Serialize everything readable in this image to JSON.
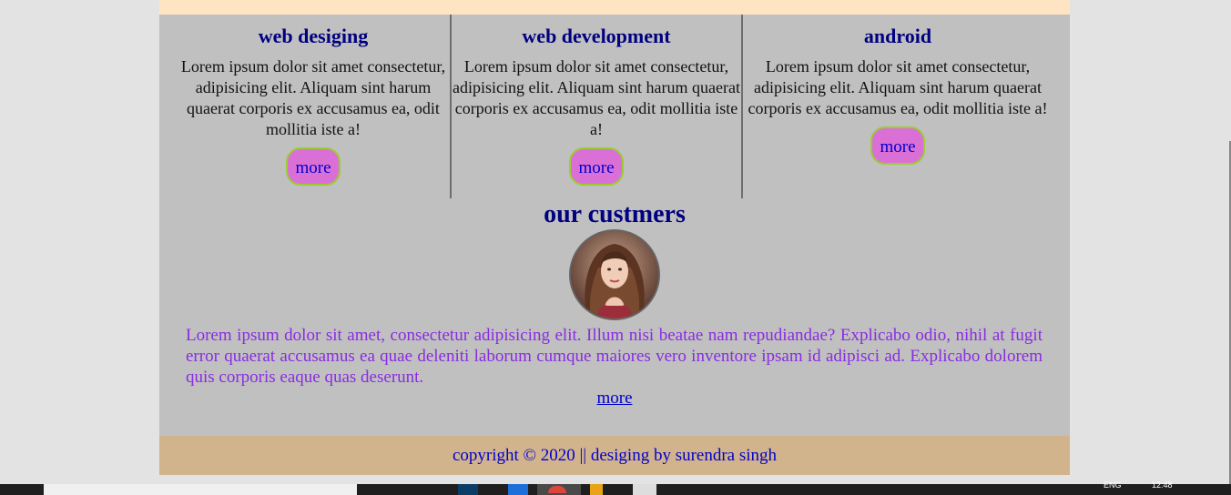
{
  "services": [
    {
      "title": "web desiging",
      "text": "Lorem ipsum dolor sit amet consectetur, adipisicing elit. Aliquam sint harum quaerat corporis ex accusamus ea, odit mollitia iste a!",
      "button": "more"
    },
    {
      "title": "web development",
      "text": "Lorem ipsum dolor sit amet consectetur, adipisicing elit. Aliquam sint harum quaerat corporis ex accusamus ea, odit mollitia iste a!",
      "button": "more"
    },
    {
      "title": "android",
      "text": "Lorem ipsum dolor sit amet consectetur, adipisicing elit. Aliquam sint harum quaerat corporis ex accusamus ea, odit mollitia iste a!",
      "button": "more"
    }
  ],
  "customers": {
    "title": "our custmers",
    "text": "Lorem ipsum dolor sit amet, consectetur adipisicing elit. Illum nisi beatae nam repudiandae? Explicabo odio, nihil at fugit error quaerat accusamus ea quae deleniti laborum cumque maiores vero inventore ipsam id adipisci ad. Explicabo dolorem quis corporis eaque quas deserunt.",
    "more_link": "more"
  },
  "footer": {
    "text": "copyright © 2020 || desiging by surendra singh"
  },
  "taskbar": {
    "lang": "ENG",
    "time": "12:48"
  },
  "colors": {
    "heading": "#000080",
    "button_bg": "#da70d6",
    "button_border": "#9acd32",
    "customer_text": "#8a2be2",
    "footer_bg": "#d2b48c",
    "top_strip": "#ffe4c4"
  }
}
